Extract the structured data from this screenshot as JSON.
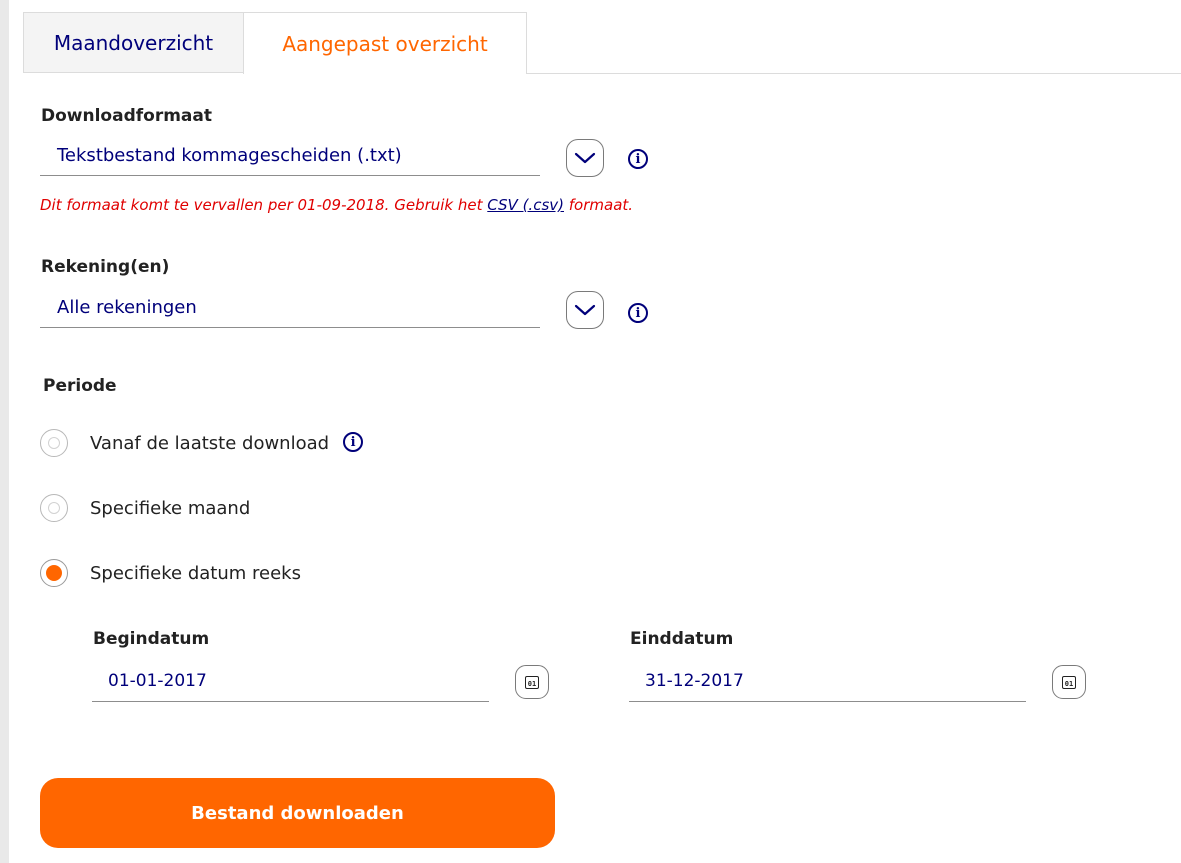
{
  "tabs": [
    {
      "label": "Maandoverzicht",
      "active": false
    },
    {
      "label": "Aangepast overzicht",
      "active": true
    }
  ],
  "download_format": {
    "label": "Downloadformaat",
    "value": "Tekstbestand kommagescheiden (.txt)",
    "warning_prefix": "Dit formaat komt te vervallen per 01-09-2018. Gebruik het",
    "warning_link": "CSV (.csv)",
    "warning_suffix": "formaat."
  },
  "accounts": {
    "label": "Rekening(en)",
    "value": "Alle rekeningen"
  },
  "period": {
    "label": "Periode",
    "options": [
      {
        "label": "Vanaf de laatste download",
        "checked": false,
        "has_info": true
      },
      {
        "label": "Specifieke maand",
        "checked": false
      },
      {
        "label": "Specifieke datum reeks",
        "checked": true
      }
    ]
  },
  "dates": {
    "start_label": "Begindatum",
    "start_value": "01-01-2017",
    "end_label": "Einddatum",
    "end_value": "31-12-2017",
    "calendar_icon_text": "01"
  },
  "info_glyph": "i",
  "submit_label": "Bestand downloaden",
  "colors": {
    "accent": "#ff6600",
    "navy": "#00007a",
    "error": "#e00000"
  }
}
